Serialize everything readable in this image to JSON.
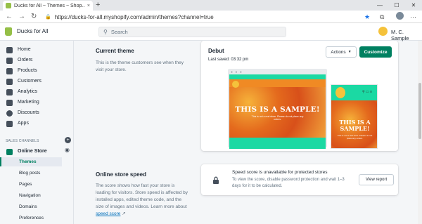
{
  "browser": {
    "tab_title": "Ducks for All ~ Themes ~ Shop...",
    "tab_close": "×",
    "new_tab": "+",
    "url": "https://ducks-for-all.myshopify.com/admin/themes?channel=true",
    "minimize": "—",
    "maximize": "☐",
    "close": "✕"
  },
  "topbar": {
    "shop_name": "Ducks for All",
    "search_placeholder": "Search",
    "user_name": "M. C. Sample"
  },
  "sidebar": {
    "items": [
      {
        "label": "Home"
      },
      {
        "label": "Orders"
      },
      {
        "label": "Products"
      },
      {
        "label": "Customers"
      },
      {
        "label": "Analytics"
      },
      {
        "label": "Marketing"
      },
      {
        "label": "Discounts"
      },
      {
        "label": "Apps"
      }
    ],
    "section_title": "SALES CHANNELS",
    "channel": "Online Store",
    "sub_items": [
      {
        "label": "Themes"
      },
      {
        "label": "Blog posts"
      },
      {
        "label": "Pages"
      },
      {
        "label": "Navigation"
      },
      {
        "label": "Domains"
      },
      {
        "label": "Preferences"
      }
    ]
  },
  "current_theme": {
    "heading": "Current theme",
    "description": "This is the theme customers see when they visit your store.",
    "theme_name": "Debut",
    "last_saved": "Last saved: 03:32 pm",
    "actions_label": "Actions",
    "customize_label": "Customize",
    "preview_title": "THIS IS A SAMPLE!",
    "preview_sub": "This is not a real store. Please do not place any orders."
  },
  "speed": {
    "heading": "Online store speed",
    "description": "The score shows how fast your store is loading for visitors. Store speed is affected by installed apps, edited theme code, and the size of images and videos. Learn more about",
    "link": "speed score",
    "alert_title": "Speed score is unavailable for protected stores",
    "alert_body": "To view the score, disable password protection and wait 1–3 days for it to be calculated.",
    "view_report_label": "View report"
  },
  "colors": {
    "brand": "#008060",
    "preview_accent": "#1bd9a3",
    "preview_duck": "#f08a24"
  }
}
